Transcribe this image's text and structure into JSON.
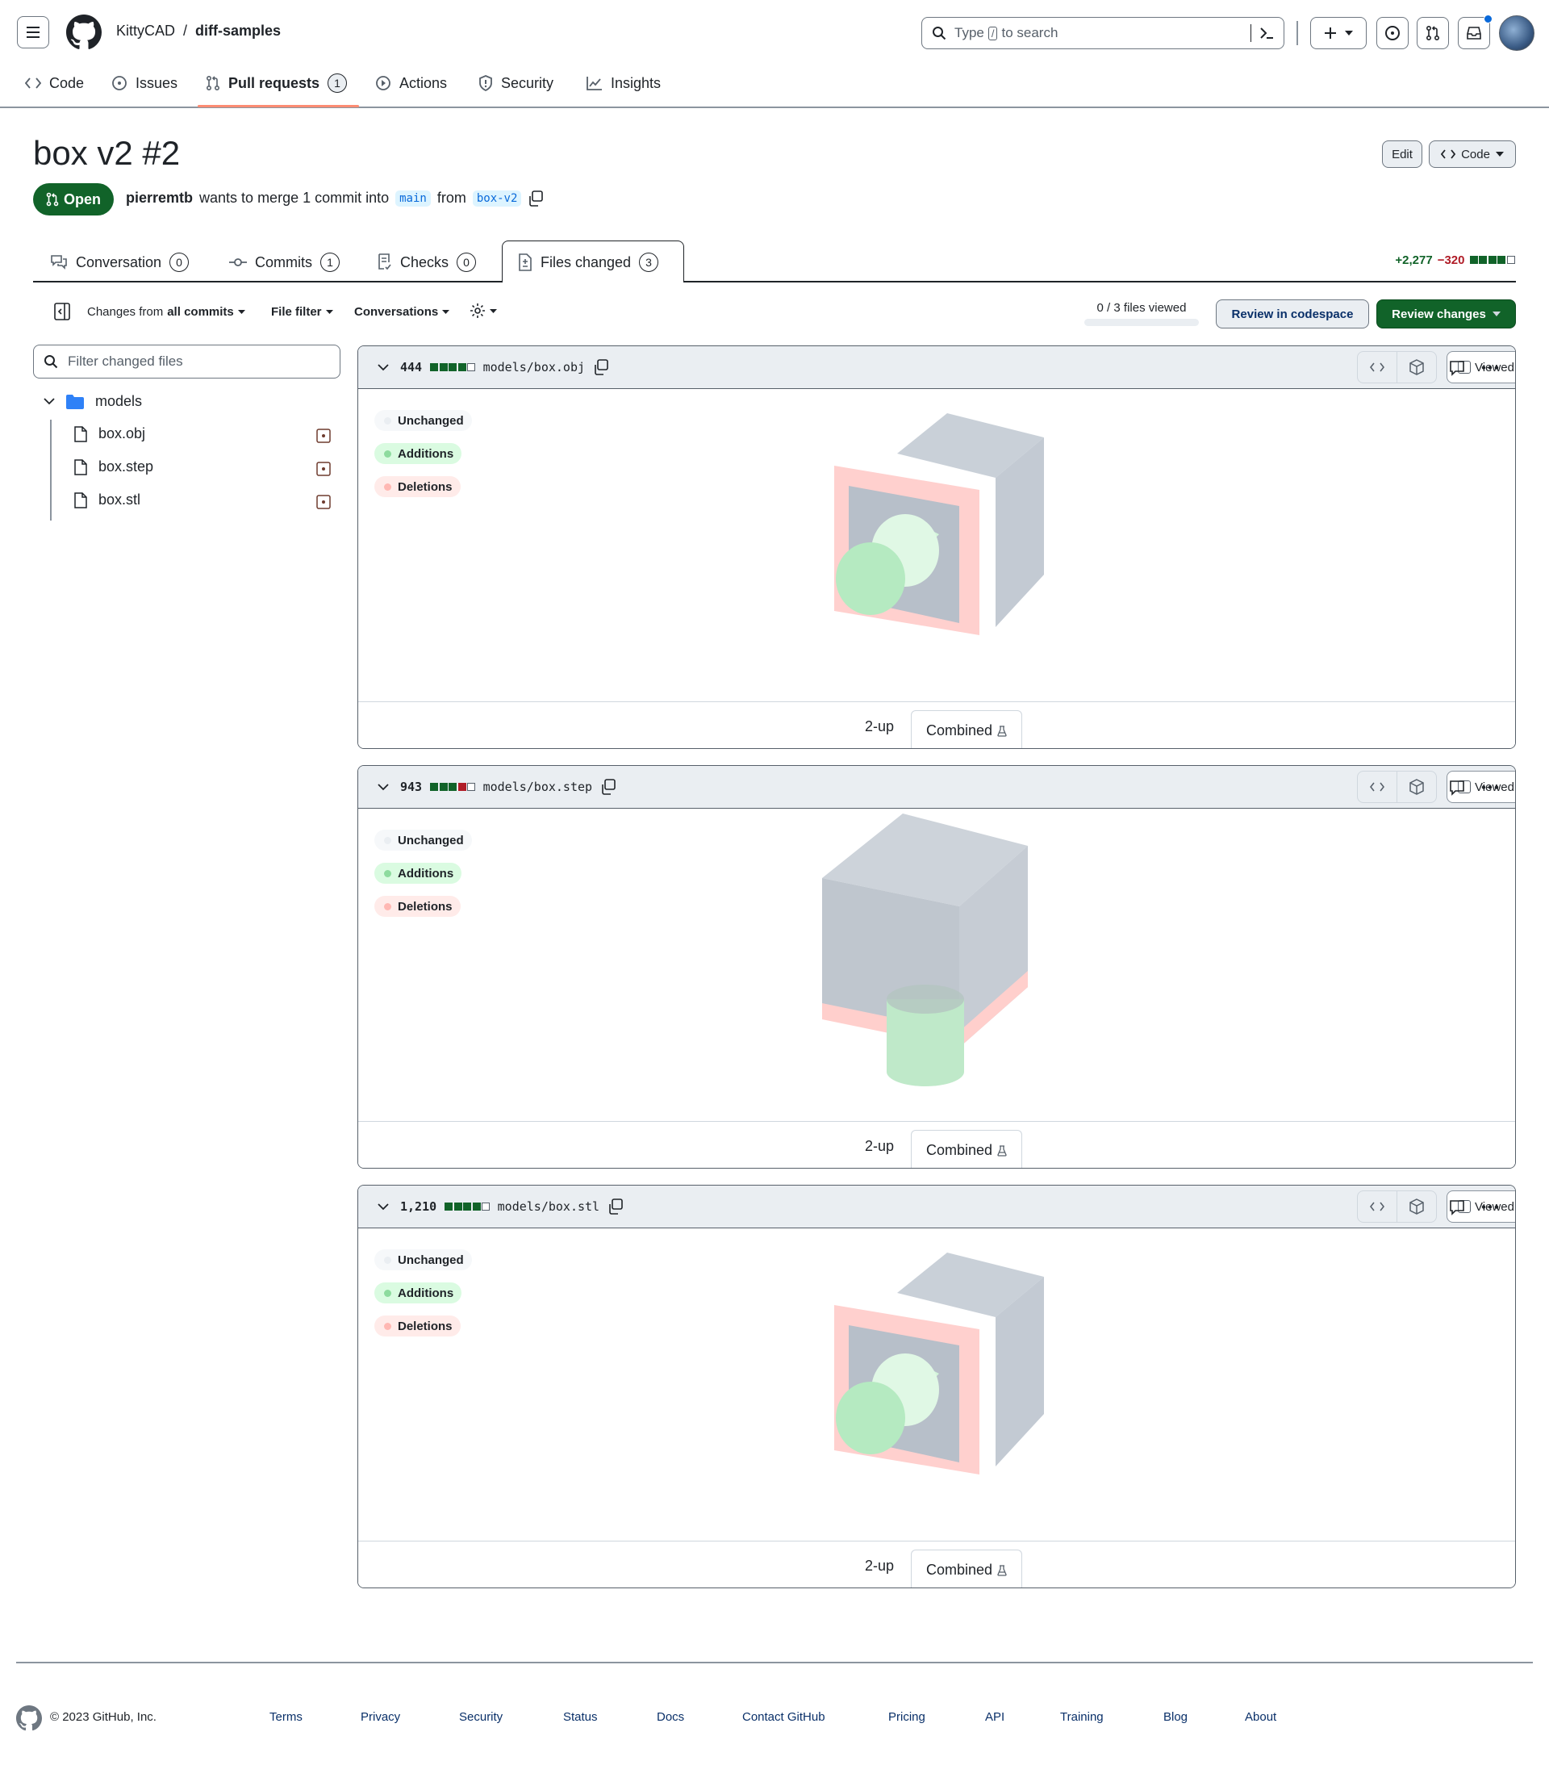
{
  "header": {
    "owner": "KittyCAD",
    "separator": "/",
    "repo": "diff-samples",
    "search_placeholder_pre": "Type",
    "search_key": "/",
    "search_placeholder_post": "to search",
    "icons": [
      "menu-icon",
      "github-logo-icon",
      "search-icon",
      "command-palette-icon",
      "plus-icon",
      "issues-icon",
      "pull-requests-icon",
      "inbox-icon",
      "avatar"
    ]
  },
  "repo_nav": [
    {
      "label": "Code",
      "icon": "code-icon"
    },
    {
      "label": "Issues",
      "icon": "issues-icon"
    },
    {
      "label": "Pull requests",
      "icon": "pull-request-icon",
      "count": "1",
      "selected": true
    },
    {
      "label": "Actions",
      "icon": "play-icon"
    },
    {
      "label": "Security",
      "icon": "shield-icon"
    },
    {
      "label": "Insights",
      "icon": "graph-icon"
    }
  ],
  "pr": {
    "title": "box v2 #2",
    "edit_label": "Edit",
    "code_label": "Code",
    "state": "Open",
    "author": "pierremtb",
    "merge_text": "wants to merge 1 commit into",
    "base_branch": "main",
    "from_text": "from",
    "head_branch": "box-v2"
  },
  "pr_tabs": [
    {
      "label": "Conversation",
      "count": "0"
    },
    {
      "label": "Commits",
      "count": "1"
    },
    {
      "label": "Checks",
      "count": "0"
    },
    {
      "label": "Files changed",
      "count": "3",
      "selected": true
    }
  ],
  "diffstat": {
    "additions": "+2,277",
    "deletions": "−320",
    "blocks": [
      "g",
      "g",
      "g",
      "g",
      "w"
    ]
  },
  "toolbar": {
    "changes_from_pre": "Changes from",
    "changes_from_bold": "all commits",
    "file_filter": "File filter",
    "conversations": "Conversations",
    "files_viewed": "0 / 3 files viewed",
    "files_viewed_progress": 0,
    "review_codespace": "Review in codespace",
    "review_changes": "Review changes"
  },
  "sidebar": {
    "filter_placeholder": "Filter changed files",
    "folder": "models",
    "files": [
      "box.obj",
      "box.step",
      "box.stl"
    ]
  },
  "files": [
    {
      "count": "444",
      "path": "models/box.obj",
      "blocks": [
        "g",
        "g",
        "g",
        "g",
        "w"
      ],
      "viewed_label": "Viewed",
      "view_2up": "2-up",
      "view_combined": "Combined"
    },
    {
      "count": "943",
      "path": "models/box.step",
      "blocks": [
        "g",
        "g",
        "g",
        "r",
        "w"
      ],
      "viewed_label": "Viewed",
      "view_2up": "2-up",
      "view_combined": "Combined"
    },
    {
      "count": "1,210",
      "path": "models/box.stl",
      "blocks": [
        "g",
        "g",
        "g",
        "g",
        "w"
      ],
      "viewed_label": "Viewed",
      "view_2up": "2-up",
      "view_combined": "Combined"
    }
  ],
  "legend": {
    "unchanged": "Unchanged",
    "additions": "Additions",
    "deletions": "Deletions"
  },
  "colors": {
    "green_primary": "#1f6f3a",
    "addition": "#b7ebc3",
    "deletion": "#ffd7d5",
    "unchanged": "#c9cfd6",
    "accent_underline": "#fd8c73"
  },
  "footer": {
    "copyright": "© 2023 GitHub, Inc.",
    "links": [
      "Terms",
      "Privacy",
      "Security",
      "Status",
      "Docs",
      "Contact GitHub",
      "Pricing",
      "API",
      "Training",
      "Blog",
      "About"
    ]
  }
}
